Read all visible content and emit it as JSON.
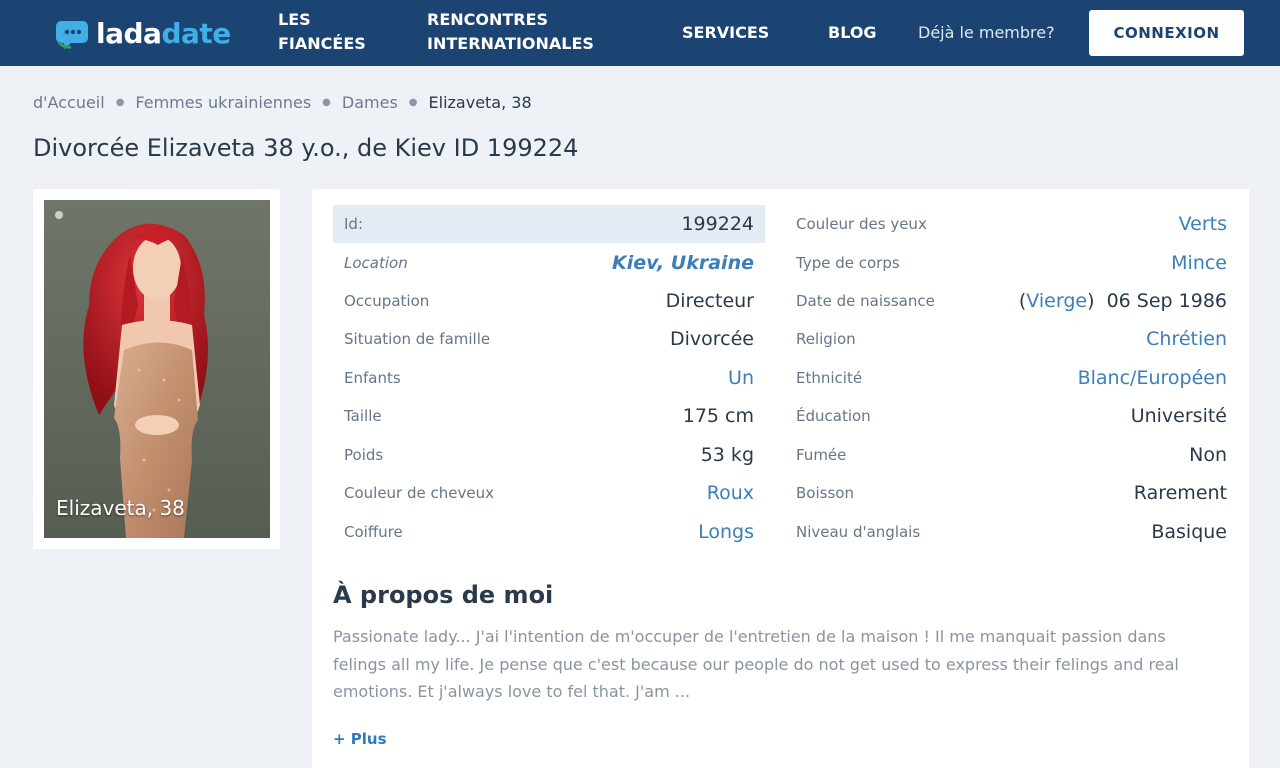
{
  "header": {
    "logo_part1": "lada",
    "logo_part2": "date",
    "nav": {
      "fiances_line1": "LES",
      "fiances_line2": "FIANCÉES",
      "rencontres_line1": "RENCONTRES",
      "rencontres_line2": "INTERNATIONALES",
      "services": "SERVICES",
      "blog": "BLOG"
    },
    "member_prompt": "Déjà le membre?",
    "login_label": "CONNEXION"
  },
  "breadcrumb": {
    "home": "d'Accueil",
    "women": "Femmes ukrainiennes",
    "ladies": "Dames",
    "current": "Elizaveta, 38"
  },
  "page_title": "Divorcée Elizaveta 38 y.o., de Kiev ID 199224",
  "photo": {
    "caption": "Elizaveta, 38"
  },
  "profile_left": [
    {
      "label": "Id:",
      "value": "199224"
    },
    {
      "label": "Location",
      "value": "Kiev, Ukraine"
    },
    {
      "label": "Occupation",
      "value": "Directeur"
    },
    {
      "label": "Situation de famille",
      "value": "Divorcée"
    },
    {
      "label": "Enfants",
      "value": "Un"
    },
    {
      "label": "Taille",
      "value": "175 cm"
    },
    {
      "label": "Poids",
      "value": "53 kg"
    },
    {
      "label": "Couleur de cheveux",
      "value": "Roux"
    },
    {
      "label": "Coiffure",
      "value": "Longs"
    }
  ],
  "profile_right": [
    {
      "label": "Couleur des yeux",
      "value": "Verts"
    },
    {
      "label": "Type de corps",
      "value": "Mince"
    },
    {
      "label": "Date de naissance",
      "zodiac": "Vierge",
      "value": "06 Sep 1986"
    },
    {
      "label": "Religion",
      "value": "Chrétien"
    },
    {
      "label": "Ethnicité",
      "value": "Blanc/Européen"
    },
    {
      "label": "Éducation",
      "value": "Université"
    },
    {
      "label": "Fumée",
      "value": "Non"
    },
    {
      "label": "Boisson",
      "value": "Rarement"
    },
    {
      "label": "Niveau d'anglais",
      "value": "Basique"
    }
  ],
  "about": {
    "title": "À propos de moi",
    "text": "Passionate lady... J'ai l'intention de m'occuper de l'entretien de la maison ! Il me manquait passion dans felings all my life. Je pense que c'est because our people do not get used to express their felings and real emotions. Et j'always love to fel that. J'am ...",
    "more_label": "+ Plus"
  },
  "colors": {
    "header_bg": "#1b4472",
    "link": "#3c7fb8",
    "logo_accent": "#41aee6",
    "page_bg": "#eef2f7"
  }
}
